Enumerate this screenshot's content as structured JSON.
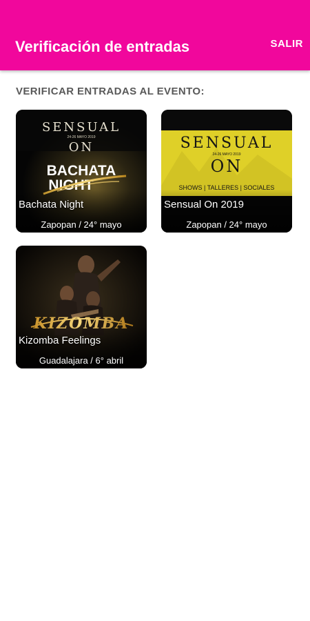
{
  "appbar": {
    "title": "Verificación de entradas",
    "action_label": "SALIR",
    "color": "#f1079c"
  },
  "section": {
    "label": "VERIFICAR ENTRADAS AL EVENTO:"
  },
  "events": [
    {
      "name": "Bachata Night",
      "meta": "Zapopan / 24° mayo",
      "poster": {
        "brand_top": "SENSUAL",
        "brand_date": "24-26 MAYO 2019",
        "brand_bottom": "ON",
        "headline_1": "BACHATA",
        "headline_2": "NIGHT"
      }
    },
    {
      "name": "Sensual On 2019",
      "meta": "Zapopan / 24° mayo",
      "poster": {
        "brand_top": "SENSUAL",
        "brand_date": "24-26 MAYO 2019",
        "brand_bottom": "ON",
        "tagline": "SHOWS | TALLERES | SOCIALES"
      }
    },
    {
      "name": "Kizomba Feelings",
      "meta": "Guadalajara / 6° abril",
      "poster": {
        "headline": "KIZOMBA"
      }
    }
  ]
}
